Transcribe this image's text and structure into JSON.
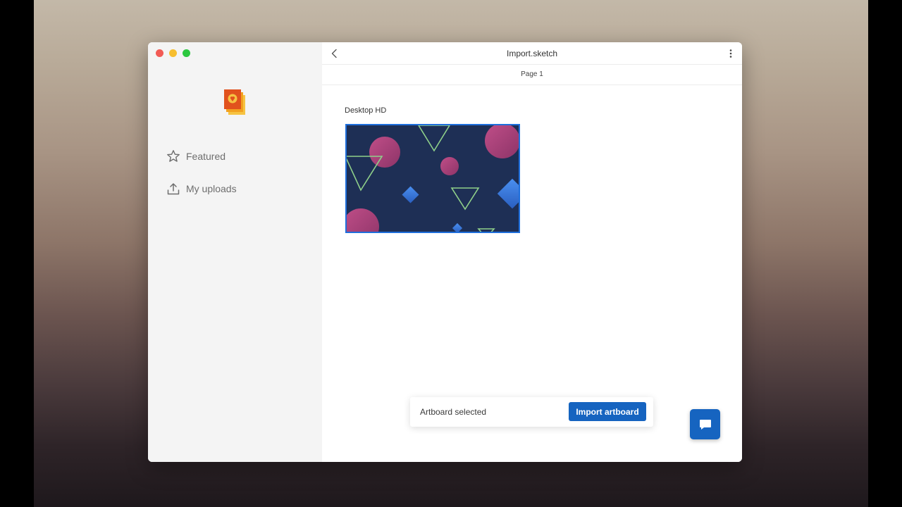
{
  "app": {
    "doc_title": "Import.sketch",
    "page_label": "Page 1"
  },
  "sidebar": {
    "items": [
      {
        "label": "Featured",
        "icon": "star-icon"
      },
      {
        "label": "My uploads",
        "icon": "upload-icon"
      }
    ]
  },
  "main": {
    "artboard_label": "Desktop HD"
  },
  "toast": {
    "text": "Artboard selected",
    "button_label": "Import artboard"
  },
  "colors": {
    "accent": "#1664c0",
    "selection": "#1f6fdc",
    "artboard_bg": "#1e2f55",
    "shape_pink": "#b0457e",
    "shape_green": "#8fd08a",
    "shape_blue": "#3b7ae0"
  },
  "icons": [
    "close-dot",
    "minimize-dot",
    "maximize-dot",
    "app-logo-icon",
    "star-icon",
    "upload-icon",
    "chevron-left-icon",
    "more-vertical-icon",
    "chat-icon",
    "cursor-hand-icon"
  ]
}
